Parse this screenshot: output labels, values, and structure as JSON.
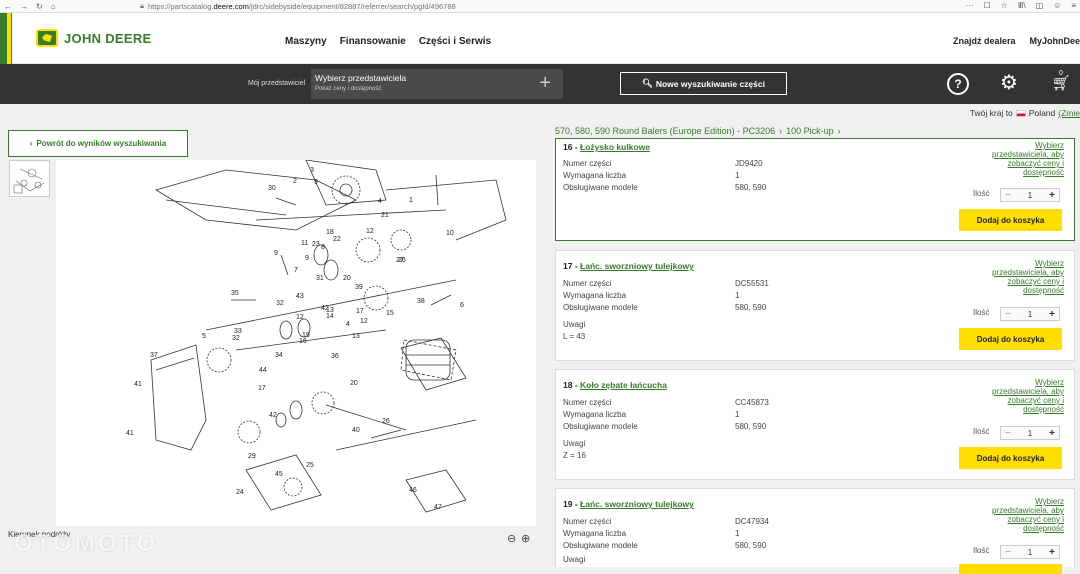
{
  "browser": {
    "nav_back": "←",
    "nav_forward": "→",
    "nav_reload": "↻",
    "nav_home": "⌂",
    "url_prefix": "https://partscatalog.",
    "url_domain": "deere.com",
    "url_rest": "/jdrc/sidebyside/equipment/82887/referrer/search/pgId/496788",
    "tools": [
      "···",
      "☐",
      "☆",
      "Ⅲ\\",
      "◫",
      "☺",
      "≡"
    ]
  },
  "header": {
    "brand": "JOHN DEERE",
    "nav": [
      "Maszyny",
      "Finansowanie",
      "Części i Serwis"
    ],
    "right": [
      "Znajdź dealera",
      "MyJohnDee"
    ]
  },
  "toolbar": {
    "dealer_label": "Mój przedstawiciel",
    "dealer_title": "Wybierz przedstawiciela",
    "dealer_sub": "Pokaż ceny i dostępność",
    "dealer_plus": "+",
    "search_label": "Nowe wyszukiwanie części",
    "search_icon": "🔍︎",
    "help_icon": "?",
    "gear_icon": "⚙",
    "cart_icon": "🛒︎",
    "cart_count": "0"
  },
  "country": {
    "label": "Twój kraj to",
    "name": "Poland",
    "link": "(Zmie"
  },
  "left": {
    "back_label": "Powrót do wyników wyszukiwania",
    "drawing_label": "Kierunek podróży",
    "zoom_out": "⊖",
    "zoom_in": "⊕",
    "watermark": "OTOMOTO"
  },
  "breadcrumb": [
    "570, 580, 590 Round Balers (Europe Edition) - PC3206",
    "100 Pick-up"
  ],
  "labels": {
    "part_no": "Numer części",
    "qty_req": "Wymagana liczba",
    "models": "Obsługiwane modele",
    "notes": "Uwagi",
    "select_dealer": "Wybierz przedstawiciela, aby zobaczyć ceny i dostępność",
    "qty": "Ilość",
    "add": "Dodaj do koszyka"
  },
  "parts": [
    {
      "num": "16 -",
      "name": "Łożysko kulkowe",
      "part_no": "JD9420",
      "qty_req": "1",
      "models": "580, 590",
      "note": "",
      "qty": "1"
    },
    {
      "num": "17 -",
      "name": "Łańc. sworzniowy tulejkowy",
      "part_no": "DC55531",
      "qty_req": "1",
      "models": "580, 590",
      "note": "L = 43",
      "qty": "1"
    },
    {
      "num": "18 -",
      "name": "Koło zębate łańcucha",
      "part_no": "CC45873",
      "qty_req": "1",
      "models": "580, 590",
      "note": "Z = 16",
      "qty": "1"
    },
    {
      "num": "19 -",
      "name": "Łańc. sworzniowy tulejkowy",
      "part_no": "DC47934",
      "qty_req": "1",
      "models": "580, 590",
      "note": "",
      "qty": "1"
    }
  ],
  "diagram_labels": [
    "30",
    "2",
    "9",
    "1",
    "3",
    "21",
    "4",
    "10",
    "12",
    "8",
    "23",
    "22",
    "18",
    "11",
    "9",
    "7",
    "31",
    "26",
    "9",
    "6",
    "20",
    "32",
    "14",
    "17",
    "43",
    "13",
    "15",
    "4",
    "13",
    "19",
    "20",
    "40",
    "37",
    "34",
    "35",
    "33",
    "32",
    "42",
    "16",
    "5",
    "36",
    "44",
    "41",
    "41",
    "17",
    "39",
    "12",
    "38",
    "27",
    "29",
    "25",
    "42",
    "45",
    "24",
    "46",
    "47",
    "26",
    "12"
  ],
  "colors": {
    "green": "#367c2b",
    "yellow": "#ffde00",
    "dark": "#333333"
  }
}
